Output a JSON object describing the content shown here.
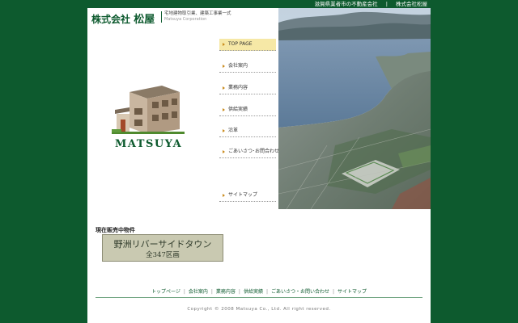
{
  "top_bar": {
    "left_label": "滋賀県業者市の不動産会社",
    "separator": "|",
    "right_label": "株式会社松屋"
  },
  "header": {
    "company_prefix": "株式会社",
    "company_name": "松屋",
    "tagline": "宅地建物取引業、建築工事業一式",
    "tagline_en": "Matsuya Corporation"
  },
  "logo": {
    "text": "MATSUYA"
  },
  "nav": {
    "items": [
      {
        "label": "TOP PAGE",
        "active": true
      },
      {
        "label": "会社案内"
      },
      {
        "label": "業務内容"
      },
      {
        "label": "供給実績"
      },
      {
        "label": "沿革"
      },
      {
        "label": "ごあいさつ･お問合わせ"
      },
      {
        "label": "サイトマップ"
      }
    ]
  },
  "sale": {
    "title": "現在販売中物件",
    "banner_line1": "野洲リバーサイドタウン",
    "banner_line2": "全347区画"
  },
  "footer": {
    "links": [
      "トップページ",
      "会社案内",
      "業務内容",
      "供給実績",
      "ごあいさつ・お問い合わせ",
      "サイトマップ"
    ],
    "separator": "|",
    "copyright": "Copyright © 2008 Matsuya Co., Ltd. All right reserved."
  },
  "colors": {
    "brand_green": "#0d5a2e",
    "nav_active_bg": "#f6e8a6",
    "nav_arrow": "#c98a1b"
  }
}
